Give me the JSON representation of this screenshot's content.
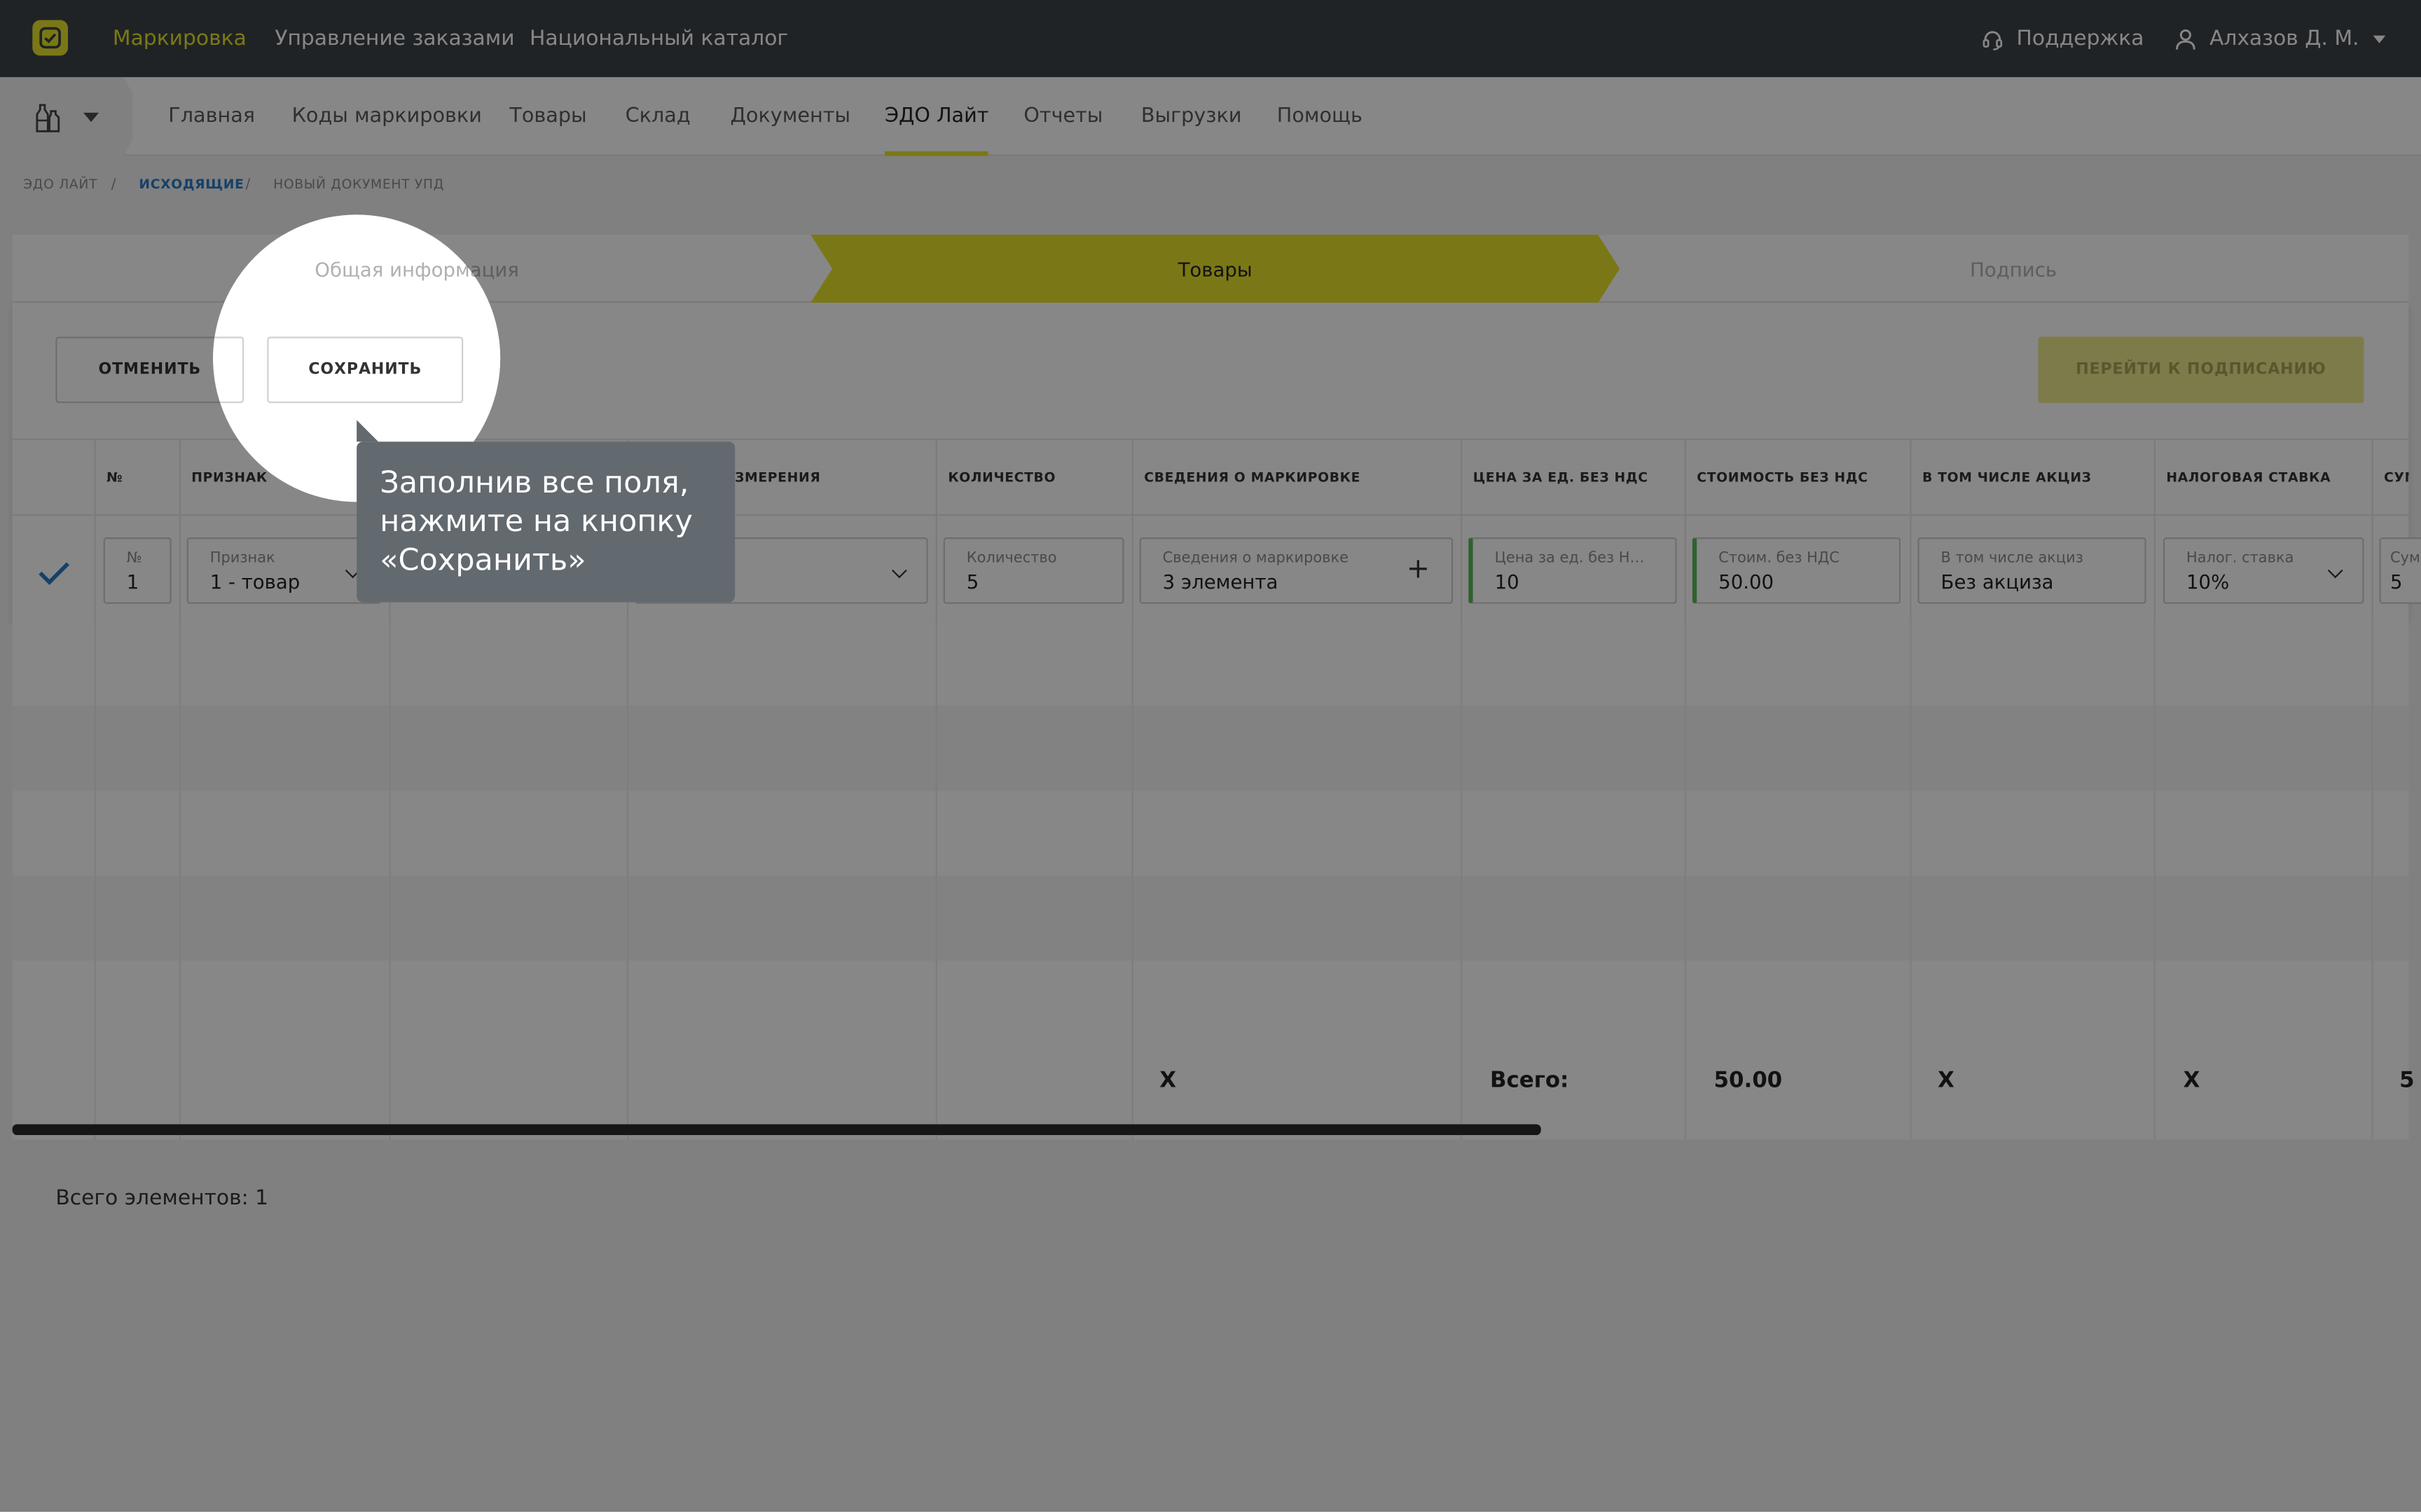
{
  "topbar": {
    "nav": [
      "Маркировка",
      "Управление заказами",
      "Национальный каталог"
    ],
    "support": "Поддержка",
    "user": "Алхазов Д. М."
  },
  "subnav": [
    "Главная",
    "Коды маркировки",
    "Товары",
    "Склад",
    "Документы",
    "ЭДО Лайт",
    "Отчеты",
    "Выгрузки",
    "Помощь"
  ],
  "breadcrumb": [
    "ЭДО ЛАЙТ",
    "ИСХОДЯЩИЕ",
    "НОВЫЙ ДОКУМЕНТ УПД"
  ],
  "steps": [
    "Общая информация",
    "Товары",
    "Подпись"
  ],
  "buttons": {
    "cancel": "ОТМЕНИТЬ",
    "save": "СОХРАНИТЬ",
    "sign": "ПЕРЕЙТИ К ПОДПИСАНИЮ"
  },
  "columns": [
    "№",
    "ПРИЗНАК",
    "ЕДИНИЦА ИЗМЕРЕНИЯ",
    "КОЛИЧЕСТВО",
    "СВЕДЕНИЯ О МАРКИРОВКЕ",
    "ЦЕНА ЗА ЕД. БЕЗ НДС",
    "СТОИМОСТЬ БЕЗ НДС",
    "В ТОМ ЧИСЛЕ АКЦИЗ",
    "НАЛОГОВАЯ СТАВКА",
    "СУММА НДС"
  ],
  "row": {
    "num": {
      "label": "№",
      "value": "1"
    },
    "sign": {
      "label": "Признак",
      "value": "1 - товар"
    },
    "qty": {
      "label": "Количество",
      "value": "5"
    },
    "marking": {
      "label": "Сведения о маркировке",
      "value": "3 элемента"
    },
    "price": {
      "label": "Цена за ед. без НДС",
      "value": "10"
    },
    "cost": {
      "label": "Стоим. без НДС",
      "value": "50.00"
    },
    "excise": {
      "label": "В том числе акциз",
      "value": "Без акциза"
    },
    "tax": {
      "label": "Налог. ставка",
      "value": "10%"
    },
    "vat": {
      "label": "Сумма НДС",
      "value": "5"
    }
  },
  "totals": {
    "marking": "X",
    "price_label": "Всего:",
    "cost": "50.00",
    "excise": "X",
    "tax": "X",
    "vat": "5"
  },
  "footer": {
    "count": "Всего элементов: 1"
  },
  "tooltip": {
    "text": "Заполнив все поля, нажмите на кнопку «Сохранить»"
  },
  "colors": {
    "accent": "#e6e22a",
    "topbar": "#3d4348",
    "valid": "#5db85c",
    "link": "#2b7cc4"
  }
}
